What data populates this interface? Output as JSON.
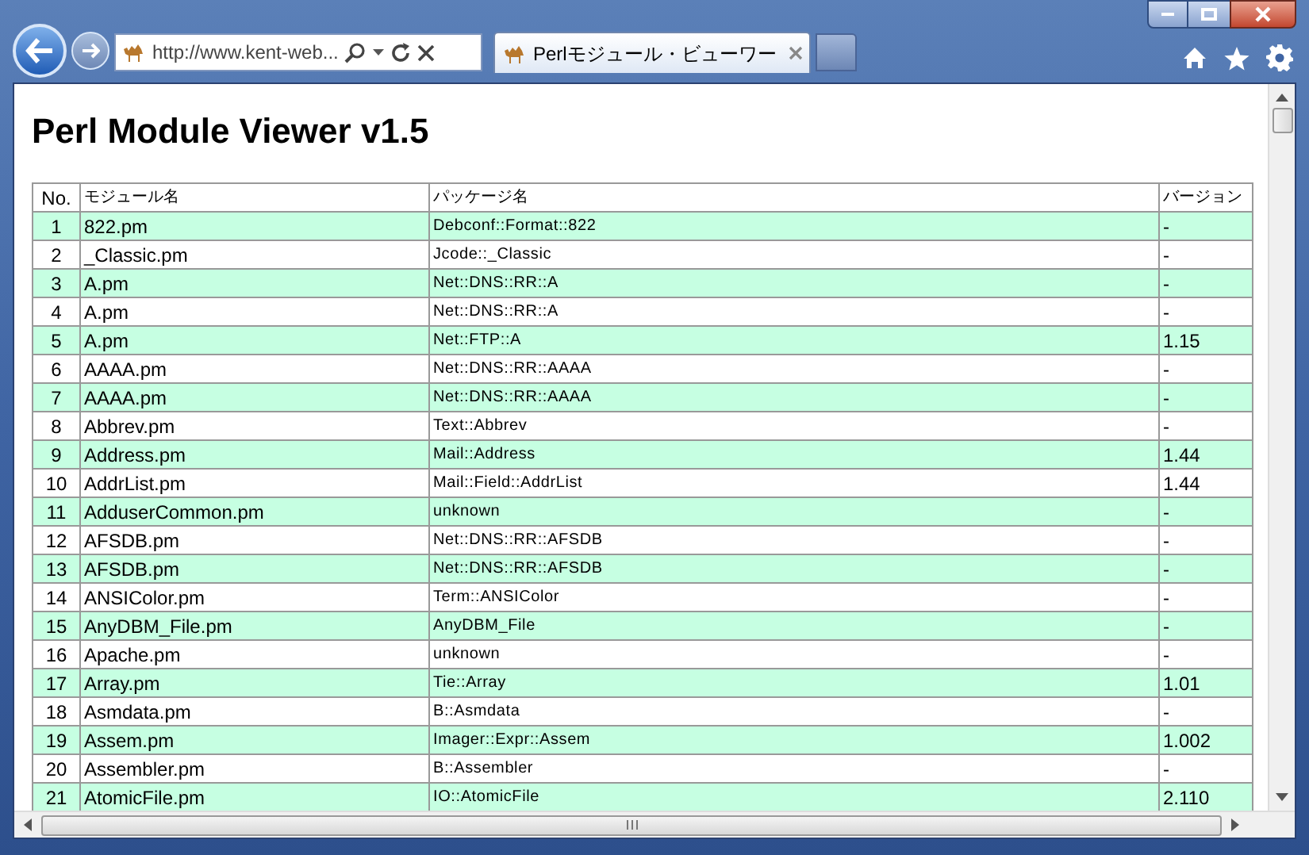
{
  "browser": {
    "address": "http://www.kent-web...",
    "tabs": [
      {
        "title": "Perlモジュール・ビューワー",
        "selected": true
      }
    ]
  },
  "page": {
    "title": "Perl Module Viewer v1.5",
    "table": {
      "columns": [
        "No.",
        "モジュール名",
        "パッケージ名",
        "バージョン"
      ],
      "rows": [
        [
          "1",
          "822.pm",
          "Debconf::Format::822",
          "-"
        ],
        [
          "2",
          "_Classic.pm",
          "Jcode::_Classic",
          "-"
        ],
        [
          "3",
          "A.pm",
          "Net::DNS::RR::A",
          "-"
        ],
        [
          "4",
          "A.pm",
          "Net::DNS::RR::A",
          "-"
        ],
        [
          "5",
          "A.pm",
          "Net::FTP::A",
          "1.15"
        ],
        [
          "6",
          "AAAA.pm",
          "Net::DNS::RR::AAAA",
          "-"
        ],
        [
          "7",
          "AAAA.pm",
          "Net::DNS::RR::AAAA",
          "-"
        ],
        [
          "8",
          "Abbrev.pm",
          "Text::Abbrev",
          "-"
        ],
        [
          "9",
          "Address.pm",
          "Mail::Address",
          "1.44"
        ],
        [
          "10",
          "AddrList.pm",
          "Mail::Field::AddrList",
          "1.44"
        ],
        [
          "11",
          "AdduserCommon.pm",
          "unknown",
          "-"
        ],
        [
          "12",
          "AFSDB.pm",
          "Net::DNS::RR::AFSDB",
          "-"
        ],
        [
          "13",
          "AFSDB.pm",
          "Net::DNS::RR::AFSDB",
          "-"
        ],
        [
          "14",
          "ANSIColor.pm",
          "Term::ANSIColor",
          "-"
        ],
        [
          "15",
          "AnyDBM_File.pm",
          "AnyDBM_File",
          "-"
        ],
        [
          "16",
          "Apache.pm",
          "unknown",
          "-"
        ],
        [
          "17",
          "Array.pm",
          "Tie::Array",
          "1.01"
        ],
        [
          "18",
          "Asmdata.pm",
          "B::Asmdata",
          "-"
        ],
        [
          "19",
          "Assem.pm",
          "Imager::Expr::Assem",
          "1.002"
        ],
        [
          "20",
          "Assembler.pm",
          "B::Assembler",
          "-"
        ],
        [
          "21",
          "AtomicFile.pm",
          "IO::AtomicFile",
          "2.110"
        ]
      ]
    }
  }
}
